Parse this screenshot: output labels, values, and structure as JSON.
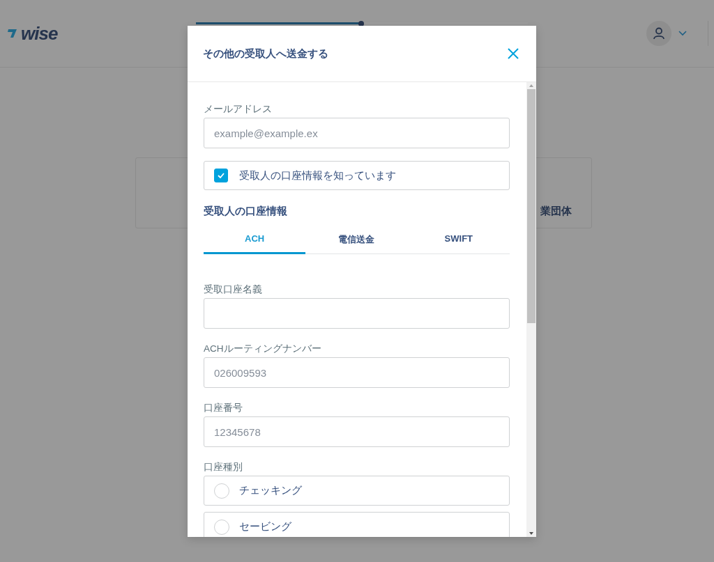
{
  "header": {
    "logo": "wise",
    "progress": {
      "level": 0.5
    }
  },
  "background_cards": [
    {
      "kind": "blank"
    },
    {
      "kind": "titled",
      "title": "業団体"
    }
  ],
  "modal": {
    "title": "その他の受取人へ送金する",
    "form": [
      {
        "kind": "input",
        "label": "メールアドレス",
        "placeholder": "example@example.ex"
      },
      {
        "kind": "checkbox",
        "label": "受取人の口座情報を知っています",
        "checked": true
      },
      {
        "kind": "heading",
        "text": "受取人の口座情報"
      },
      {
        "kind": "tabs",
        "tabs": [
          {
            "label": "ACH",
            "selected": true
          },
          {
            "label": "電信送金",
            "selected": false
          },
          {
            "label": "SWIFT",
            "selected": false
          }
        ]
      },
      {
        "kind": "input",
        "label": "受取口座名義"
      },
      {
        "kind": "input",
        "label": "ACHルーティングナンバー",
        "placeholder": "026009593"
      },
      {
        "kind": "input",
        "label": "口座番号",
        "placeholder": "12345678"
      },
      {
        "kind": "radio_group",
        "label": "口座種別",
        "options": [
          {
            "label": "チェッキング",
            "selected": false
          },
          {
            "label": "セービング",
            "selected": false
          }
        ]
      }
    ]
  }
}
